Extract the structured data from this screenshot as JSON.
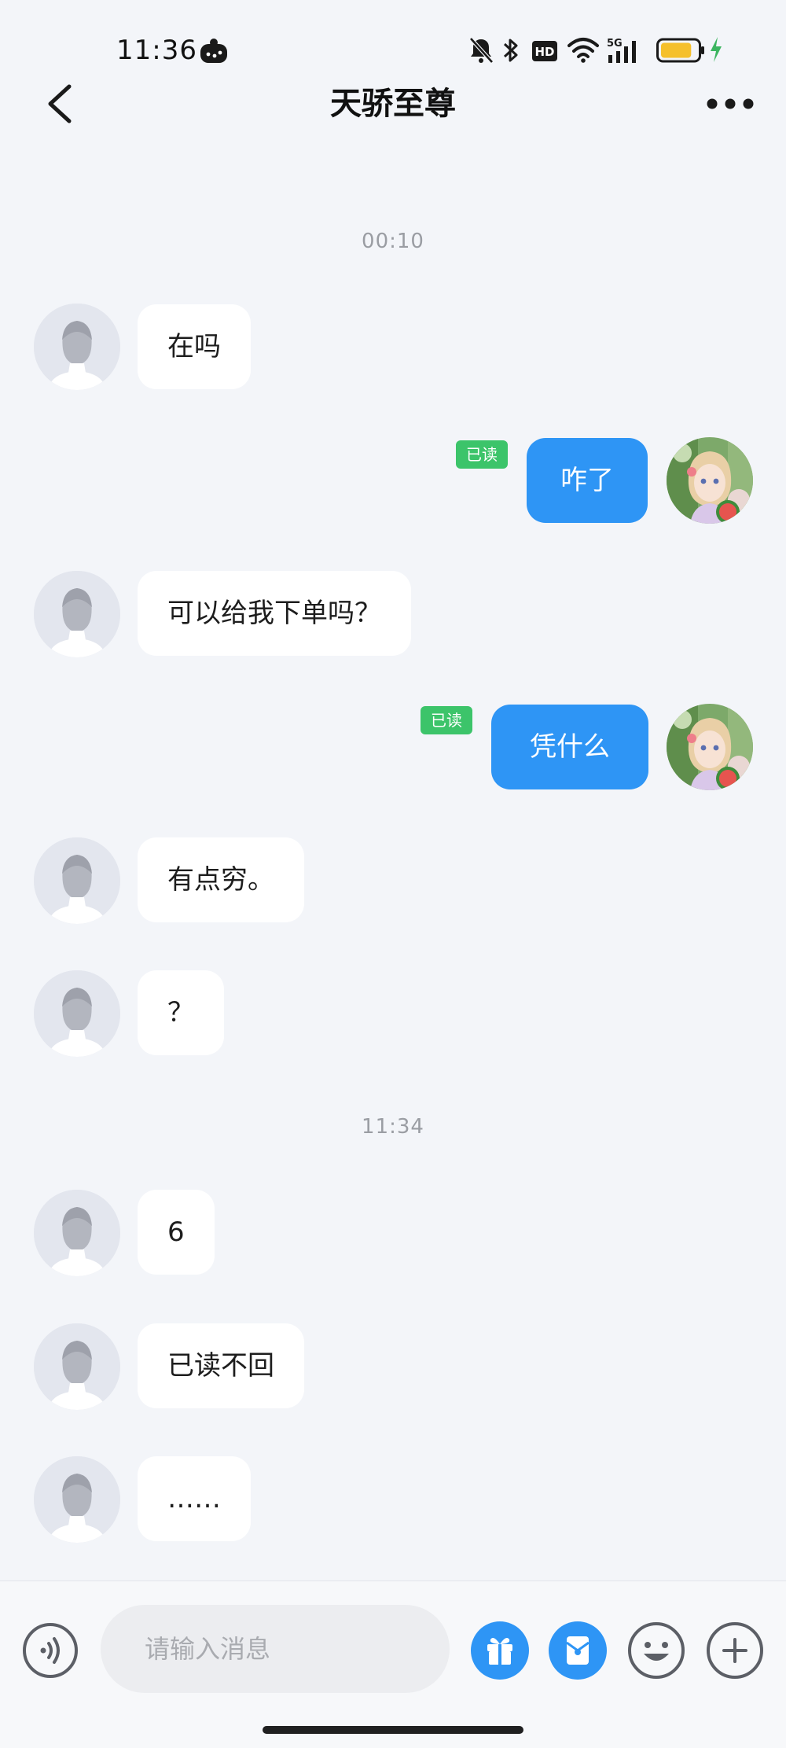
{
  "status_bar": {
    "time": "11:36",
    "hd_label": "HD",
    "network_label": "5G",
    "battery_level": 0.85,
    "battery_color": "#f5c02c",
    "charging_color": "#3cb560"
  },
  "header": {
    "title": "天骄至尊"
  },
  "messages": {
    "time_1": "00:10",
    "time_2": "11:34",
    "m1": "在吗",
    "m2": "咋了",
    "m3": "可以给我下单吗？",
    "m4": "凭什么",
    "m5": "有点穷。",
    "m6": "？",
    "m7": "6",
    "m8": "已读不回",
    "m9": "……",
    "read_label": "已读"
  },
  "input_bar": {
    "placeholder": "请输入消息"
  },
  "colors": {
    "accent": "#2e95f5",
    "read_badge": "#3cc46a",
    "background": "#f3f5f9"
  },
  "icons": {
    "back": "chevron-left-icon",
    "more": "ellipsis-icon",
    "voice": "voice-icon",
    "gift": "gift-icon",
    "red_packet": "red-packet-icon",
    "emoji": "emoji-icon",
    "plus": "plus-icon"
  }
}
